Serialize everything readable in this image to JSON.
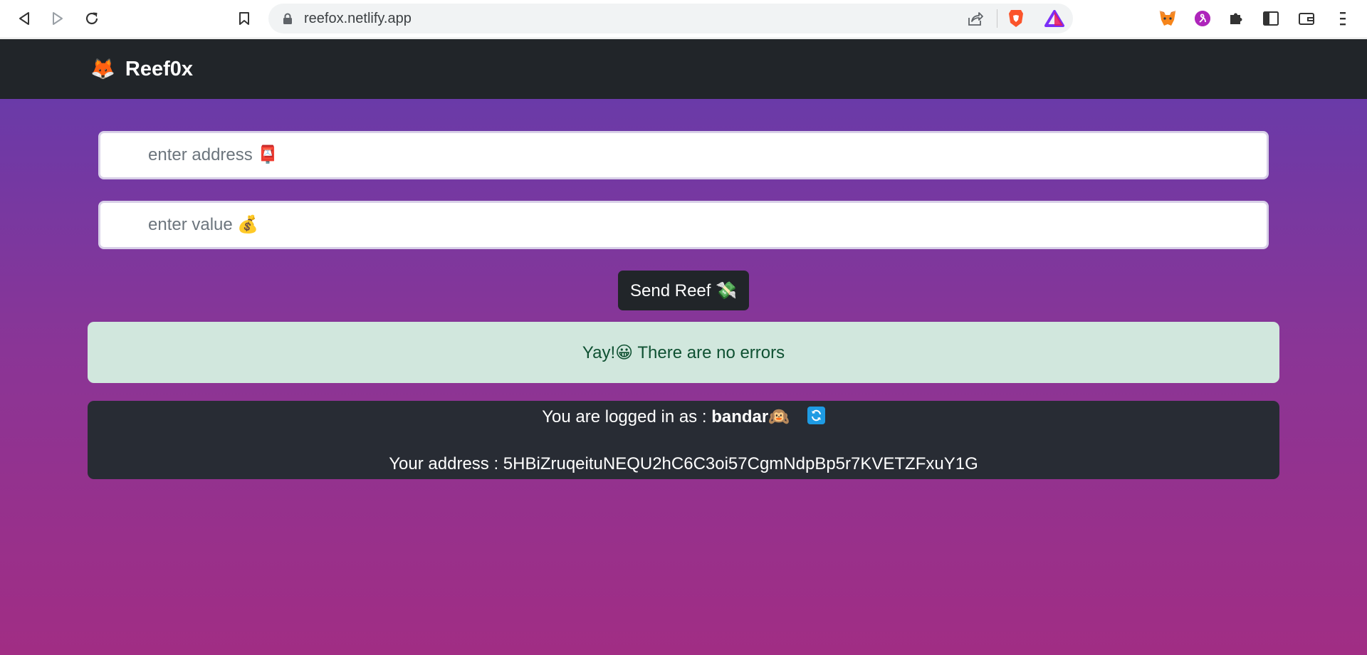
{
  "browser": {
    "url": "reefox.netlify.app"
  },
  "brand": {
    "icon": "🦊",
    "name": "Reef0x"
  },
  "form": {
    "address_placeholder": "enter address 📮",
    "value_placeholder": "enter value 💰",
    "send_label": "Send Reef 💸"
  },
  "alert": {
    "message": "Yay!😀 There are no errors",
    "color": "#d1e7dd"
  },
  "account": {
    "logged_in_prefix": "You are logged in as : ",
    "username": "bandar🙉",
    "address_line": "Your address : 5HBiZruqeituNEQU2hC6C3oi57CgmNdpBp5r7KVETZFxuY1G"
  },
  "colors": {
    "header": "#212529",
    "gradient_top": "#6a3aa8",
    "gradient_bottom": "#a12d84",
    "info_panel": "#282c34"
  }
}
